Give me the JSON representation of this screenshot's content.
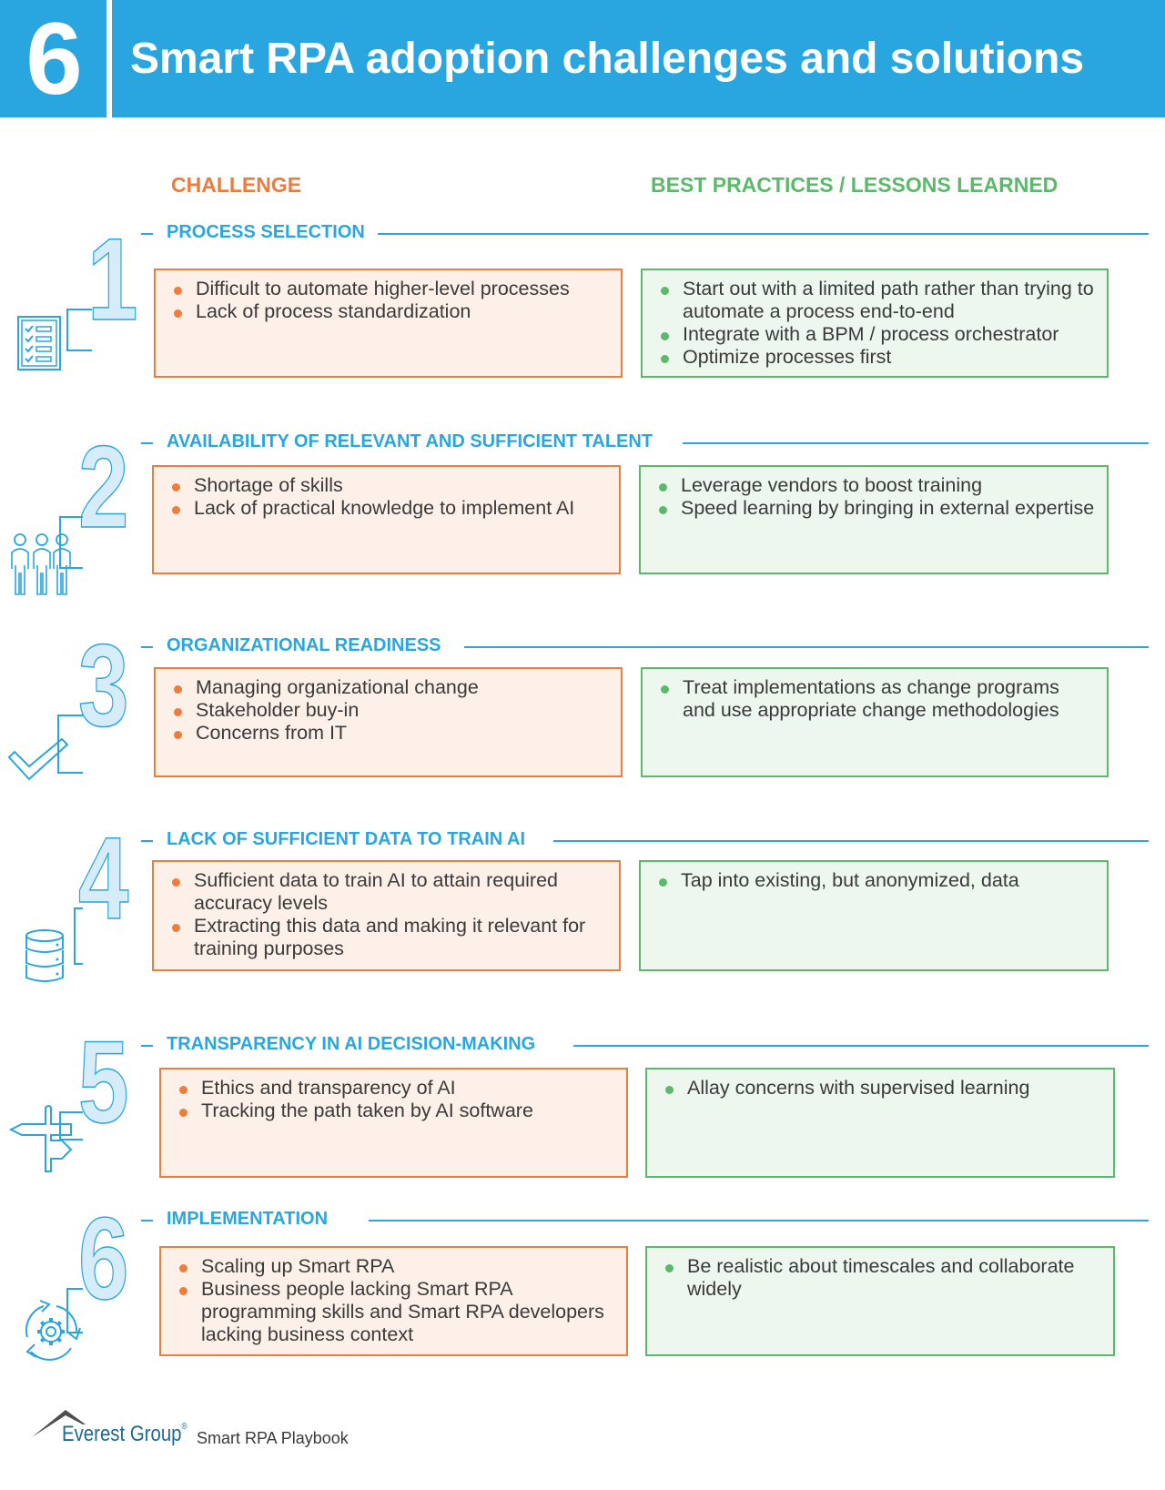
{
  "header": {
    "section_number": "6",
    "title": "Smart RPA adoption challenges and solutions"
  },
  "columns": {
    "challenge_heading": "CHALLENGE",
    "practice_heading": "BEST PRACTICES / LESSONS LEARNED"
  },
  "colors": {
    "brand_blue": "#29a6df",
    "challenge_orange": "#ee7c3a",
    "practice_green": "#5cb86a"
  },
  "sections": [
    {
      "number": "1",
      "title": "PROCESS SELECTION",
      "icon": "checklist-icon",
      "challenges": [
        "Difficult to automate higher-level processes",
        "Lack of process standardization"
      ],
      "practices": [
        "Start out with a limited path rather than trying to automate a process end-to-end",
        "Integrate with a BPM / process orchestrator",
        "Optimize processes first"
      ]
    },
    {
      "number": "2",
      "title": "AVAILABILITY OF RELEVANT AND SUFFICIENT TALENT",
      "icon": "people-icon",
      "challenges": [
        "Shortage of skills",
        "Lack of practical knowledge to implement AI"
      ],
      "practices": [
        "Leverage vendors to boost training",
        "Speed learning by bringing in external expertise"
      ]
    },
    {
      "number": "3",
      "title": "ORGANIZATIONAL READINESS",
      "icon": "checkmark-icon",
      "challenges": [
        "Managing organizational change",
        "Stakeholder buy-in",
        "Concerns from IT"
      ],
      "practices": [
        "Treat implementations as change programs and use appropriate change methodologies"
      ]
    },
    {
      "number": "4",
      "title": "LACK OF SUFFICIENT DATA TO TRAIN AI",
      "icon": "database-icon",
      "challenges": [
        "Sufficient data to train AI to attain required accuracy levels",
        "Extracting this data and making it relevant for training purposes"
      ],
      "practices": [
        "Tap into existing, but anonymized, data"
      ]
    },
    {
      "number": "5",
      "title": "TRANSPARENCY IN AI DECISION-MAKING",
      "icon": "signpost-icon",
      "challenges": [
        "Ethics and transparency of AI",
        "Tracking the path taken by AI software"
      ],
      "practices": [
        "Allay concerns with supervised learning"
      ]
    },
    {
      "number": "6",
      "title": "IMPLEMENTATION",
      "icon": "gear-cycle-icon",
      "challenges": [
        "Scaling up Smart RPA",
        "Business people lacking Smart RPA programming skills and Smart RPA developers lacking business context"
      ],
      "practices": [
        "Be realistic about timescales and collaborate widely"
      ]
    }
  ],
  "footer": {
    "brand": "Everest Group",
    "registered_mark": "®",
    "publication": "Smart RPA Playbook"
  }
}
